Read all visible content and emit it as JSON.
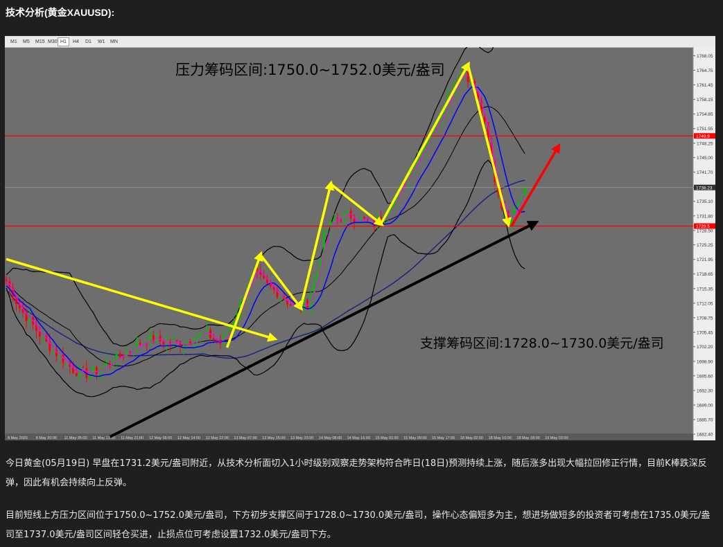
{
  "heading": "技术分析(黄金XAUUSD):",
  "timeframes": [
    "M1",
    "M5",
    "M15",
    "M30",
    "H1",
    "H4",
    "D1",
    "W1",
    "MN"
  ],
  "active_timeframe": "H1",
  "paragraphs": [
    "今日黄金(05月19日) 早盘在1731.2美元/盎司附近，从技术分析面切入1小时级别观察走势架构符合昨日(18日)预测持续上涨，随后涨多出现大幅拉回修正行情，目前K棒跌深反弹，因此有机会持续向上反弹。",
    "目前短线上方压力区间位于1750.0~1752.0美元/盎司，下方初步支撑区间于1728.0~1730.0美元/盎司，操作心态偏短多为主，想进场做短多的投资者可考虑在1735.0美元/盎司至1737.0美元/盎司区间轻仓买进，止损点位可考虑设置1732.0美元/盎司下方。"
  ],
  "colors": {
    "background": "#6e6e6e",
    "resistance_line": "#ff0000",
    "up_candle": "#00c000",
    "down_candle": "#ff0000",
    "ma_fast": "#0000ff",
    "ma_long": "#1a237e",
    "trend_arrow": "#ffff00",
    "forecast_arrow": "#ff0000",
    "support_trend": "#000000"
  },
  "chart_data": {
    "type": "candlestick",
    "symbol": "XAUUSD",
    "timeframe": "H1",
    "ylim": [
      1681.0,
      1770.0
    ],
    "y_ticks": [
      "1768.05",
      "1764.75",
      "1761.45",
      "1758.15",
      "1754.85",
      "1751.55",
      "1748.25",
      "1745.00",
      "1741.70",
      "1738.23",
      "1735.10",
      "1731.80",
      "1728.50",
      "1725.25",
      "1721.95",
      "1718.65",
      "1715.35",
      "1712.05",
      "1708.75",
      "1705.45",
      "1702.20",
      "1698.90",
      "1695.60",
      "1692.30",
      "1689.00",
      "1685.70",
      "1682.40"
    ],
    "x_ticks": [
      "8 May 2020",
      "8 May 20:00",
      "11 May 05:00",
      "11 May 13:00",
      "11 May 21:00",
      "12 May 06:00",
      "12 May 14:00",
      "12 May 22:00",
      "13 May 07:00",
      "13 May 15:00",
      "13 May 23:00",
      "14 May 08:00",
      "14 May 16:00",
      "15 May 01:00",
      "15 May 09:00",
      "15 May 17:00",
      "18 May 02:00",
      "18 May 10:00",
      "18 May 18:00",
      "19 May 03:00"
    ],
    "horizontal_lines": [
      {
        "value": 1749.9,
        "label": "1749.9"
      },
      {
        "value": 1729.5,
        "label": "1729.5"
      }
    ],
    "current_price": {
      "value": 1738.23,
      "label": "1738.23"
    },
    "close_path": [
      [
        0,
        1717
      ],
      [
        4,
        1711
      ],
      [
        8,
        1707
      ],
      [
        12,
        1703
      ],
      [
        16,
        1700
      ],
      [
        20,
        1697
      ],
      [
        24,
        1696
      ],
      [
        28,
        1697
      ],
      [
        32,
        1699
      ],
      [
        36,
        1701
      ],
      [
        40,
        1703
      ],
      [
        44,
        1704
      ],
      [
        48,
        1703
      ],
      [
        52,
        1703
      ],
      [
        56,
        1704
      ],
      [
        60,
        1705
      ],
      [
        64,
        1703
      ],
      [
        66,
        1705
      ],
      [
        70,
        1712
      ],
      [
        74,
        1719
      ],
      [
        78,
        1716
      ],
      [
        82,
        1714
      ],
      [
        86,
        1711
      ],
      [
        90,
        1712
      ],
      [
        93,
        1719
      ],
      [
        95,
        1727
      ],
      [
        98,
        1731
      ],
      [
        102,
        1732
      ],
      [
        106,
        1731
      ],
      [
        110,
        1730
      ],
      [
        114,
        1733
      ],
      [
        116,
        1735
      ],
      [
        119,
        1740
      ],
      [
        122,
        1744
      ],
      [
        125,
        1748
      ],
      [
        128,
        1752
      ],
      [
        131,
        1757
      ],
      [
        134,
        1762
      ],
      [
        137,
        1765
      ],
      [
        140,
        1760
      ],
      [
        143,
        1752
      ],
      [
        146,
        1740
      ],
      [
        149,
        1732
      ],
      [
        150,
        1731
      ],
      [
        152,
        1734
      ],
      [
        154,
        1737
      ],
      [
        155,
        1738
      ]
    ],
    "annotations": [
      {
        "text": "压力筹码区间:1750.0~1752.0美元/盎司",
        "role": "resistance"
      },
      {
        "text": "支撑筹码区间:1728.0~1730.0美元/盎司",
        "role": "support"
      }
    ]
  }
}
